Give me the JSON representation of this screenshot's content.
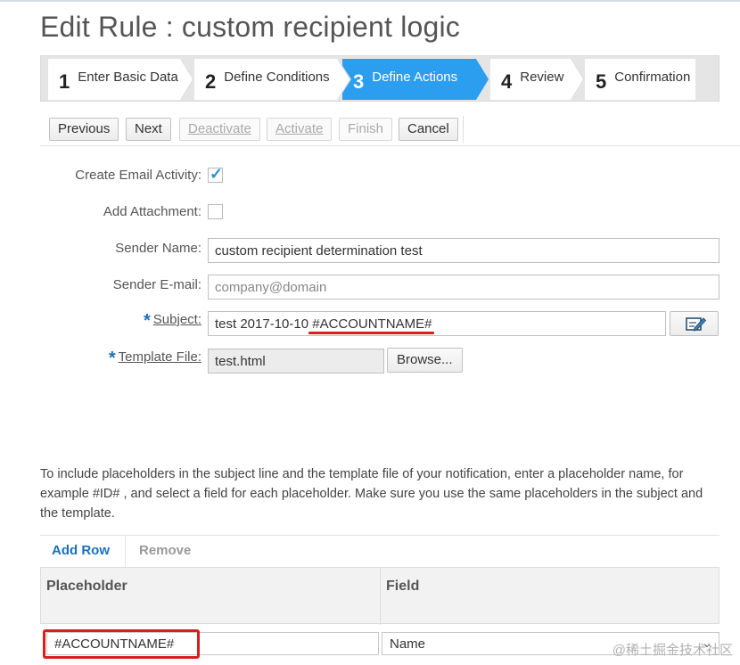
{
  "page": {
    "title": "Edit Rule : custom recipient logic"
  },
  "wizard": {
    "steps": [
      {
        "num": "1",
        "label": "Enter Basic Data"
      },
      {
        "num": "2",
        "label": "Define Conditions"
      },
      {
        "num": "3",
        "label": "Define Actions"
      },
      {
        "num": "4",
        "label": "Review"
      },
      {
        "num": "5",
        "label": "Confirmation"
      }
    ],
    "active_step": "3"
  },
  "toolbar": {
    "previous": "Previous",
    "next": "Next",
    "deactivate": "Deactivate",
    "activate": "Activate",
    "finish": "Finish",
    "cancel": "Cancel"
  },
  "form": {
    "create_email_activity": {
      "label": "Create Email Activity:",
      "checked": true
    },
    "add_attachment": {
      "label": "Add Attachment:",
      "checked": false
    },
    "sender_name": {
      "label": "Sender Name:",
      "value": "custom recipient determination test"
    },
    "sender_email": {
      "label": "Sender E-mail:",
      "placeholder": "company@domain"
    },
    "subject": {
      "required": "*",
      "label": "Subject:",
      "value": "test 2017-10-10 #ACCOUNTNAME#"
    },
    "template_file": {
      "required": "*",
      "label": "Template File:",
      "value": "test.html",
      "browse": "Browse..."
    }
  },
  "info_text": "To include placeholders in the subject line and the template file of your notification, enter a placeholder name, for example #ID# , and select a field for each placeholder. Make sure you use the same placeholders in the subject and the template.",
  "table": {
    "add_row": "Add Row",
    "remove": "Remove",
    "columns": [
      "Placeholder",
      "Field"
    ],
    "rows": [
      {
        "placeholder": "#ACCOUNTNAME#",
        "field": "Name"
      }
    ]
  },
  "watermark": "@稀土掘金技术社区",
  "colors": {
    "accent": "#2b9ef0",
    "link": "#1a70bd",
    "highlight_red": "#d61f1f"
  }
}
